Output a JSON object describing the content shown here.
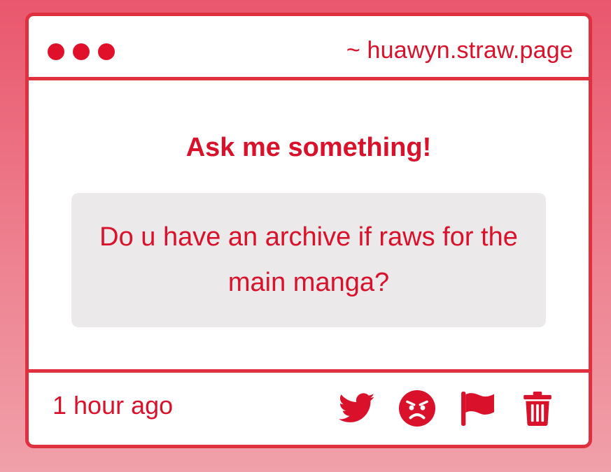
{
  "window": {
    "url": "~ huawyn.straw.page"
  },
  "content": {
    "heading": "Ask me something!",
    "question": "Do u have an archive if raws for the main manga?"
  },
  "footer": {
    "timestamp": "1 hour ago",
    "actions": [
      {
        "icon": "twitter-icon"
      },
      {
        "icon": "angry-face-icon"
      },
      {
        "icon": "flag-icon"
      },
      {
        "icon": "trash-icon"
      }
    ]
  },
  "colors": {
    "accent": "#d9112a",
    "border": "#e0303f",
    "question_bg": "#ebe9ea",
    "background_top": "#e9576d",
    "background_bottom": "#f0a0aa"
  }
}
